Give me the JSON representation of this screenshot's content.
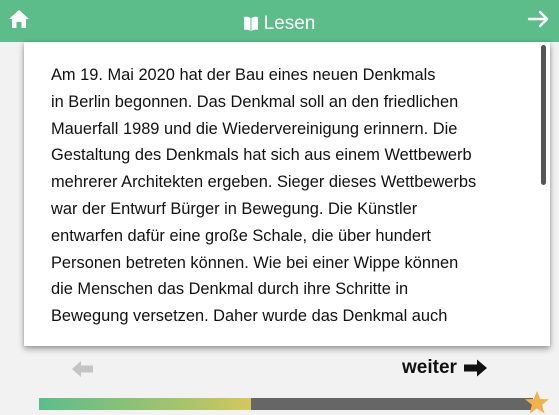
{
  "colors": {
    "header": "#5cbd8b",
    "card": "#ffffff",
    "progress_track": "#666666",
    "star": "#f0b24a",
    "prev_disabled": "#c4c4c4"
  },
  "header": {
    "title": "Lesen",
    "title_icon": "book-icon",
    "left_icon": "home-icon",
    "right_icon": "arrow-right-icon"
  },
  "reading": {
    "lines": [
      "Am 19. Mai 2020 hat der Bau eines neuen Denkmals",
      "in Berlin begonnen. Das Denkmal soll an den friedlichen",
      "Mauerfall 1989 und die Wiedervereinigung erinnern. Die",
      "Gestaltung des Denkmals hat sich aus einem Wettbewerb",
      "mehrerer Architekten ergeben. Sieger dieses Wettbewerbs",
      "war der Entwurf Bürger in Bewegung. Die Künstler",
      "entwarfen dafür eine große Schale, die über hundert",
      "Personen betreten können. Wie bei einer Wippe können",
      "die Menschen das Denkmal durch ihre Schritte in",
      "Bewegung versetzen. Daher wurde das Denkmal auch"
    ]
  },
  "footer": {
    "prev_icon": "arrow-left-icon",
    "weiter_label": "weiter",
    "weiter_icon": "arrow-right-icon",
    "progress_fraction": 0.43,
    "end_icon": "star-icon"
  }
}
